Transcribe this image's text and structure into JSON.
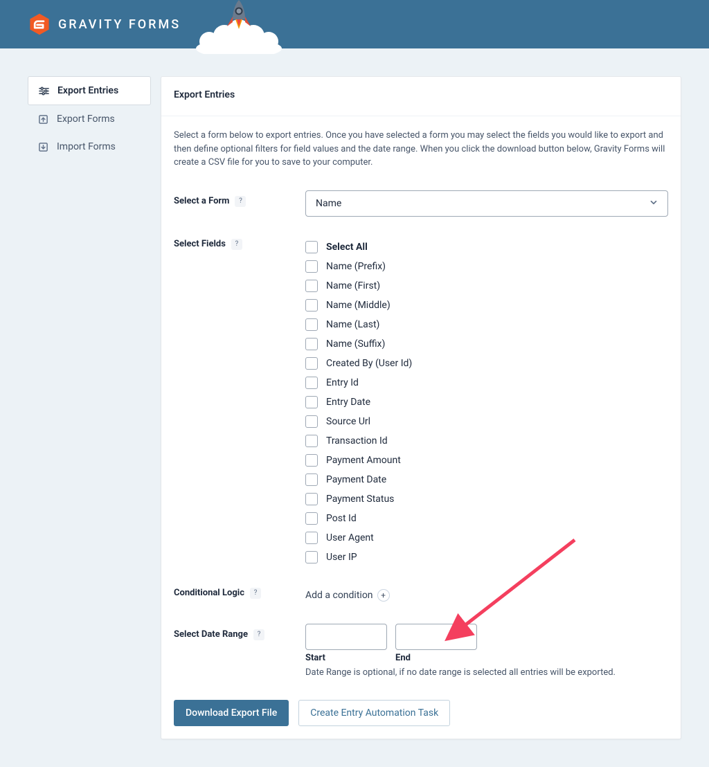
{
  "brand": {
    "name": "GRAVITY FORMS"
  },
  "sidebar": {
    "items": [
      {
        "label": "Export Entries",
        "active": true
      },
      {
        "label": "Export Forms",
        "active": false
      },
      {
        "label": "Import Forms",
        "active": false
      }
    ]
  },
  "panel": {
    "title": "Export Entries",
    "intro": "Select a form below to export entries. Once you have selected a form you may select the fields you would like to export and then define optional filters for field values and the date range. When you click the download button below, Gravity Forms will create a CSV file for you to save to your computer."
  },
  "form": {
    "select_form_label": "Select a Form",
    "selected_form": "Name",
    "select_fields_label": "Select Fields",
    "fields": [
      {
        "label": "Select All",
        "bold": true
      },
      {
        "label": "Name (Prefix)",
        "bold": false
      },
      {
        "label": "Name (First)",
        "bold": false
      },
      {
        "label": "Name (Middle)",
        "bold": false
      },
      {
        "label": "Name (Last)",
        "bold": false
      },
      {
        "label": "Name (Suffix)",
        "bold": false
      },
      {
        "label": "Created By (User Id)",
        "bold": false
      },
      {
        "label": "Entry Id",
        "bold": false
      },
      {
        "label": "Entry Date",
        "bold": false
      },
      {
        "label": "Source Url",
        "bold": false
      },
      {
        "label": "Transaction Id",
        "bold": false
      },
      {
        "label": "Payment Amount",
        "bold": false
      },
      {
        "label": "Payment Date",
        "bold": false
      },
      {
        "label": "Payment Status",
        "bold": false
      },
      {
        "label": "Post Id",
        "bold": false
      },
      {
        "label": "User Agent",
        "bold": false
      },
      {
        "label": "User IP",
        "bold": false
      }
    ],
    "conditional_label": "Conditional Logic",
    "add_condition_label": "Add a condition",
    "date_range_label": "Select Date Range",
    "date_start_label": "Start",
    "date_end_label": "End",
    "date_range_note": "Date Range is optional, if no date range is selected all entries will be exported."
  },
  "buttons": {
    "download": "Download Export File",
    "create_task": "Create Entry Automation Task"
  },
  "help_tooltip": "?"
}
